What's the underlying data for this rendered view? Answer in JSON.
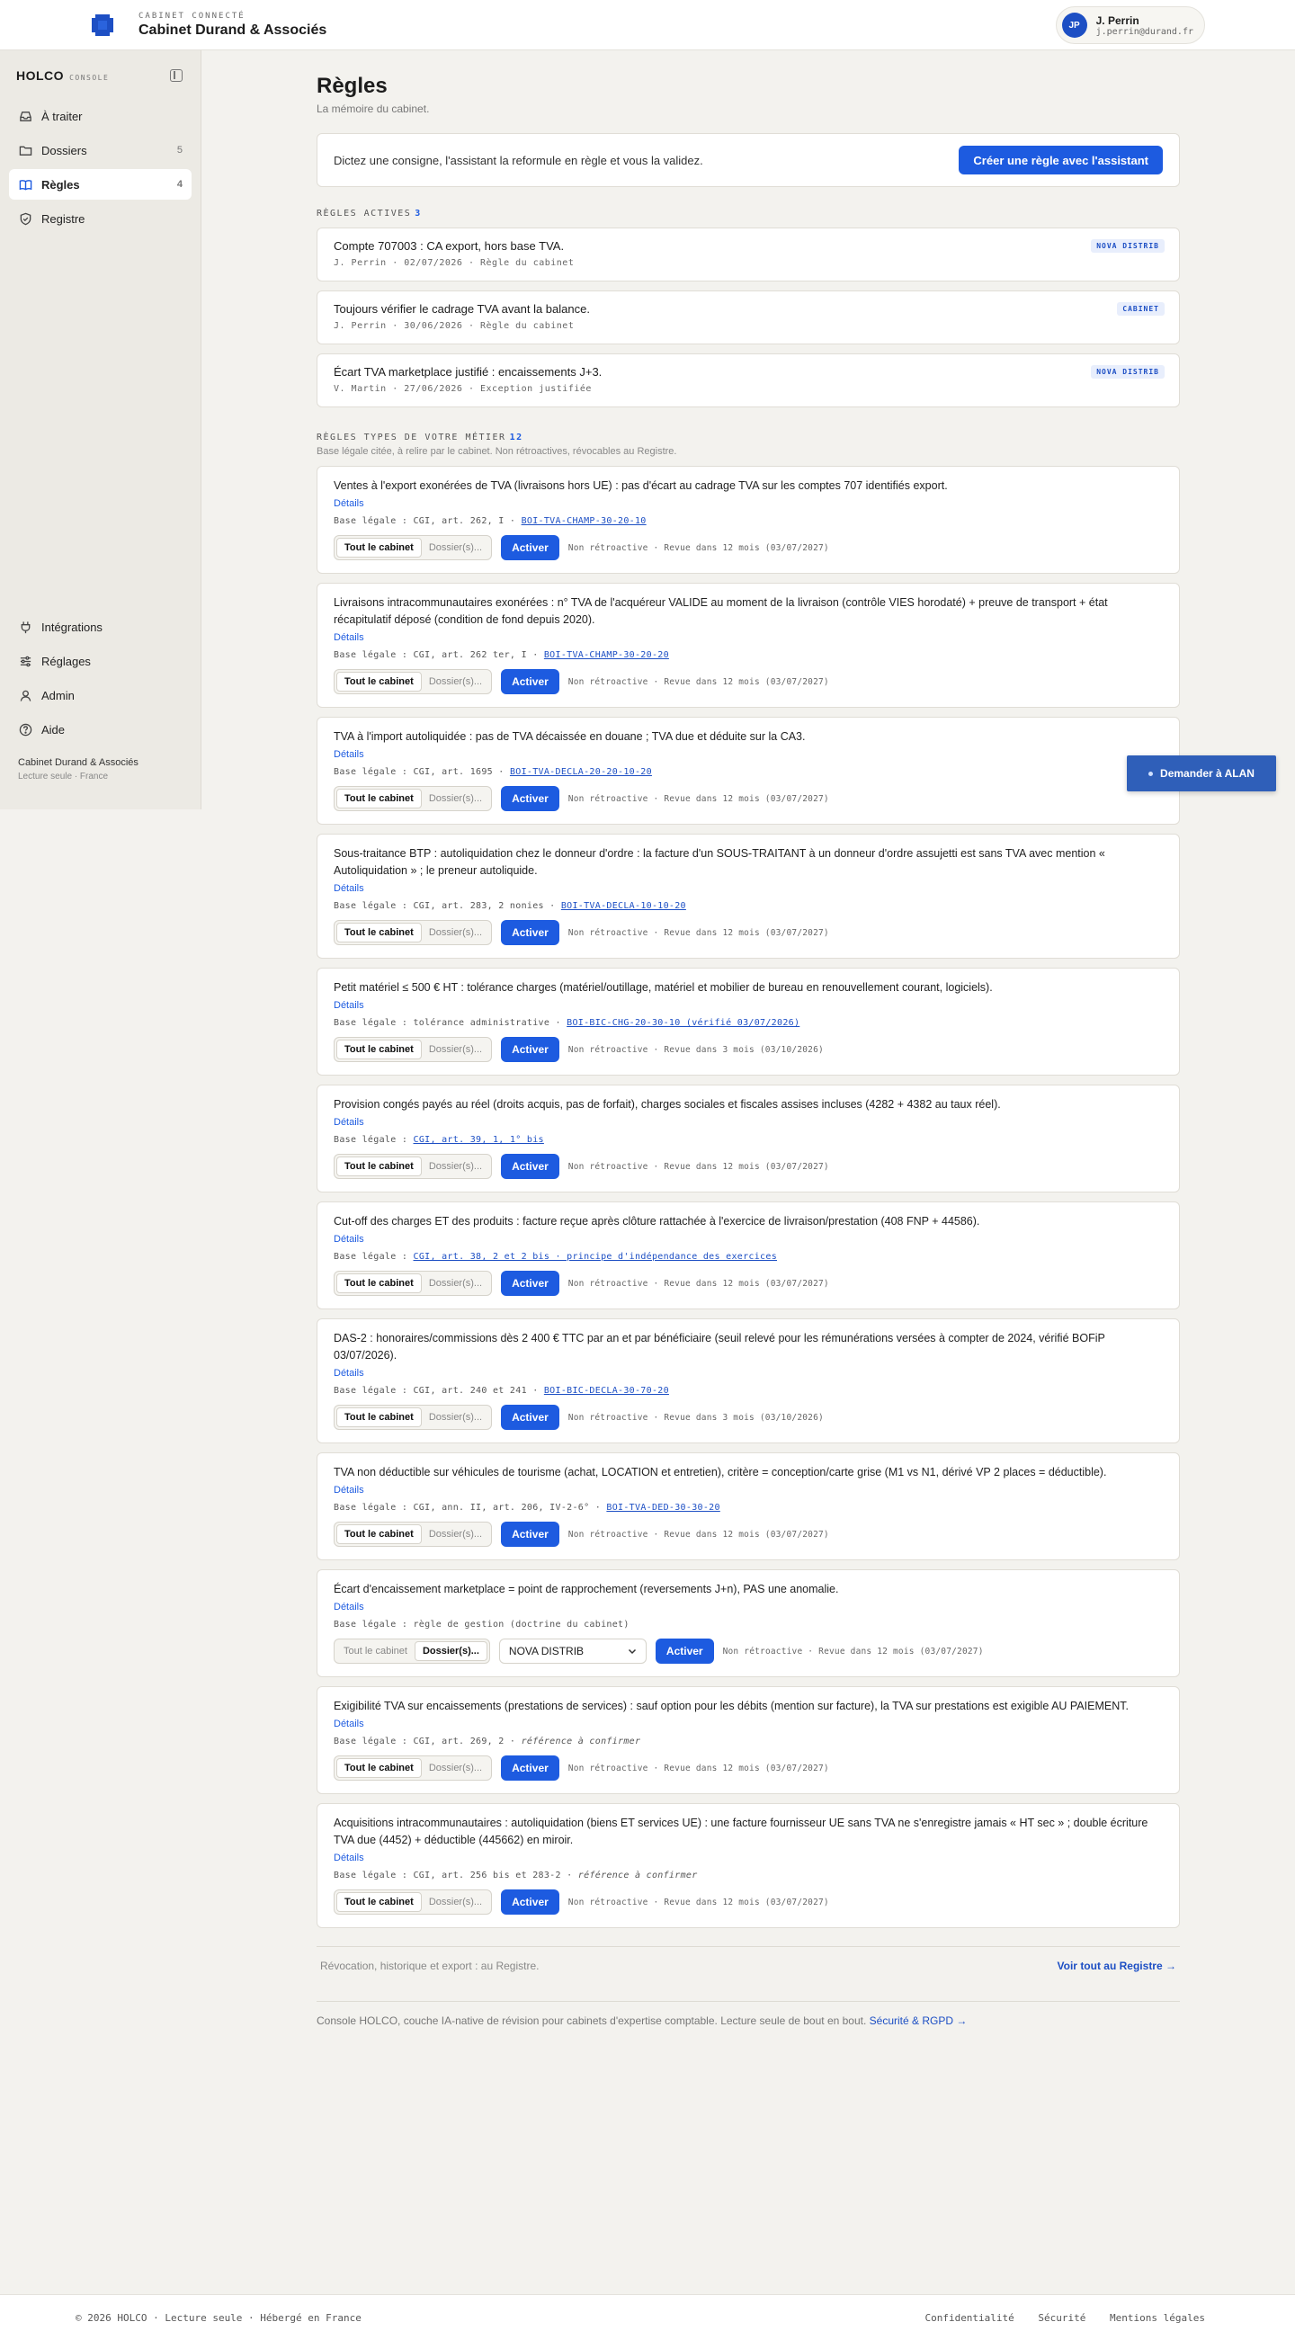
{
  "header": {
    "tag": "CABINET CONNECTÉ",
    "name": "Cabinet Durand & Associés",
    "user_initials": "JP",
    "user_name": "J. Perrin",
    "user_email": "j.perrin@durand.fr"
  },
  "sidebar": {
    "brand": "HOLCO",
    "brand_sub": "CONSOLE",
    "items": [
      {
        "label": "À traiter",
        "count": ""
      },
      {
        "label": "Dossiers",
        "count": "5"
      },
      {
        "label": "Règles",
        "count": "4"
      },
      {
        "label": "Registre",
        "count": ""
      }
    ],
    "bottom_items": [
      {
        "label": "Intégrations"
      },
      {
        "label": "Réglages"
      },
      {
        "label": "Admin"
      },
      {
        "label": "Aide"
      }
    ],
    "footer_name": "Cabinet Durand & Associés",
    "footer_sub": "Lecture seule · France"
  },
  "main": {
    "title": "Règles",
    "subtitle": "La mémoire du cabinet.",
    "assist_text": "Dictez une consigne, l'assistant la reformule en règle et vous la validez.",
    "assist_button": "Créer une règle avec l'assistant",
    "active_title": "RÈGLES ACTIVES",
    "active_count": "3",
    "active_rules": [
      {
        "text": "Compte 707003 : CA export, hors base TVA.",
        "meta": "J. Perrin · 02/07/2026 · Règle du cabinet",
        "badge": "NOVA DISTRIB"
      },
      {
        "text": "Toujours vérifier le cadrage TVA avant la balance.",
        "meta": "J. Perrin · 30/06/2026 · Règle du cabinet",
        "badge": "CABINET"
      },
      {
        "text": "Écart TVA marketplace justifié : encaissements J+3.",
        "meta": "V. Martin · 27/06/2026 · Exception justifiée",
        "badge": "NOVA DISTRIB"
      }
    ],
    "types_title": "RÈGLES TYPES DE VOTRE MÉTIER",
    "types_count": "12",
    "types_sub": "Base légale citée, à relire par le cabinet. Non rétroactives, révocables au Registre.",
    "labels": {
      "details": "Détails",
      "scope_all": "Tout le cabinet",
      "scope_files": "Dossier(s)...",
      "activate": "Activer",
      "select_value": "NOVA DISTRIB"
    },
    "type_rules": [
      {
        "text": "Ventes à l'export exonérées de TVA (livraisons hors UE) : pas d'écart au cadrage TVA sur les comptes 707 identifiés export.",
        "legal_prefix": "Base légale : CGI, art. 262, I · ",
        "legal_link": "BOI-TVA-CHAMP-30-20-10",
        "legal_note": "",
        "note": "Non rétroactive · Revue dans 12 mois (03/07/2027)"
      },
      {
        "text": "Livraisons intracommunautaires exonérées : n° TVA de l'acquéreur VALIDE au moment de la livraison (contrôle VIES horodaté) + preuve de transport + état récapitulatif déposé (condition de fond depuis 2020).",
        "legal_prefix": "Base légale : CGI, art. 262 ter, I · ",
        "legal_link": "BOI-TVA-CHAMP-30-20-20",
        "legal_note": "",
        "note": "Non rétroactive · Revue dans 12 mois (03/07/2027)"
      },
      {
        "text": "TVA à l'import autoliquidée : pas de TVA décaissée en douane ; TVA due et déduite sur la CA3.",
        "legal_prefix": "Base légale : CGI, art. 1695 · ",
        "legal_link": "BOI-TVA-DECLA-20-20-10-20",
        "legal_note": "",
        "note": "Non rétroactive · Revue dans 12 mois (03/07/2027)"
      },
      {
        "text": "Sous-traitance BTP : autoliquidation chez le donneur d'ordre : la facture d'un SOUS-TRAITANT à un donneur d'ordre assujetti est sans TVA avec mention « Autoliquidation » ; le preneur autoliquide.",
        "legal_prefix": "Base légale : CGI, art. 283, 2 nonies · ",
        "legal_link": "BOI-TVA-DECLA-10-10-20",
        "legal_note": "",
        "note": "Non rétroactive · Revue dans 12 mois (03/07/2027)"
      },
      {
        "text": "Petit matériel ≤ 500 € HT : tolérance charges (matériel/outillage, matériel et mobilier de bureau en renouvellement courant, logiciels).",
        "legal_prefix": "Base légale : tolérance administrative · ",
        "legal_link": "BOI-BIC-CHG-20-30-10 (vérifié 03/07/2026)",
        "legal_note": "",
        "note": "Non rétroactive · Revue dans 3 mois (03/10/2026)"
      },
      {
        "text": "Provision congés payés au réel (droits acquis, pas de forfait), charges sociales et fiscales assises incluses (4282 + 4382 au taux réel).",
        "legal_prefix": "Base légale : ",
        "legal_link": "CGI, art. 39, 1, 1° bis",
        "legal_note": "",
        "note": "Non rétroactive · Revue dans 12 mois (03/07/2027)"
      },
      {
        "text": "Cut-off des charges ET des produits : facture reçue après clôture rattachée à l'exercice de livraison/prestation (408 FNP + 44586).",
        "legal_prefix": "Base légale : ",
        "legal_link": "CGI, art. 38, 2 et 2 bis · principe d'indépendance des exercices",
        "legal_note": "",
        "note": "Non rétroactive · Revue dans 12 mois (03/07/2027)"
      },
      {
        "text": "DAS-2 : honoraires/commissions dès 2 400 € TTC par an et par bénéficiaire (seuil relevé pour les rémunérations versées à compter de 2024, vérifié BOFiP 03/07/2026).",
        "legal_prefix": "Base légale : CGI, art. 240 et 241 · ",
        "legal_link": "BOI-BIC-DECLA-30-70-20",
        "legal_note": "",
        "note": "Non rétroactive · Revue dans 3 mois (03/10/2026)"
      },
      {
        "text": "TVA non déductible sur véhicules de tourisme (achat, LOCATION et entretien), critère = conception/carte grise (M1 vs N1, dérivé VP 2 places = déductible).",
        "legal_prefix": "Base légale : CGI, ann. II, art. 206, IV-2-6° · ",
        "legal_link": "BOI-TVA-DED-30-30-20",
        "legal_note": "",
        "note": "Non rétroactive · Revue dans 12 mois (03/07/2027)"
      },
      {
        "text": "Écart d'encaissement marketplace = point de rapprochement (reversements J+n), PAS une anomalie.",
        "legal_prefix": "Base légale : règle de gestion (doctrine du cabinet)",
        "legal_link": "",
        "legal_note": "",
        "note": "Non rétroactive · Revue dans 12 mois (03/07/2027)",
        "files_scope": true
      },
      {
        "text": "Exigibilité TVA sur encaissements (prestations de services) : sauf option pour les débits (mention sur facture), la TVA sur prestations est exigible AU PAIEMENT.",
        "legal_prefix": "Base légale : CGI, art. 269, 2 · ",
        "legal_link": "",
        "legal_note": "référence à confirmer",
        "note": "Non rétroactive · Revue dans 12 mois (03/07/2027)"
      },
      {
        "text": "Acquisitions intracommunautaires : autoliquidation (biens ET services UE) : une facture fournisseur UE sans TVA ne s'enregistre jamais « HT sec » ; double écriture TVA due (4452) + déductible (445662) en miroir.",
        "legal_prefix": "Base légale : CGI, art. 256 bis et 283-2 · ",
        "legal_link": "",
        "legal_note": "référence à confirmer",
        "note": "Non rétroactive · Revue dans 12 mois (03/07/2027)"
      }
    ],
    "registry_text": "Révocation, historique et export : au Registre.",
    "registry_link": "Voir tout au Registre →",
    "console_note": "Console HOLCO, couche IA-native de révision pour cabinets d'expertise comptable. Lecture seule de bout en bout.",
    "console_link": "Sécurité & RGPD →"
  },
  "float_button": "Demander à ALAN",
  "footer": {
    "left": "© 2026 HOLCO · Lecture seule · Hébergé en France",
    "links": [
      "Confidentialité",
      "Sécurité",
      "Mentions légales"
    ]
  }
}
